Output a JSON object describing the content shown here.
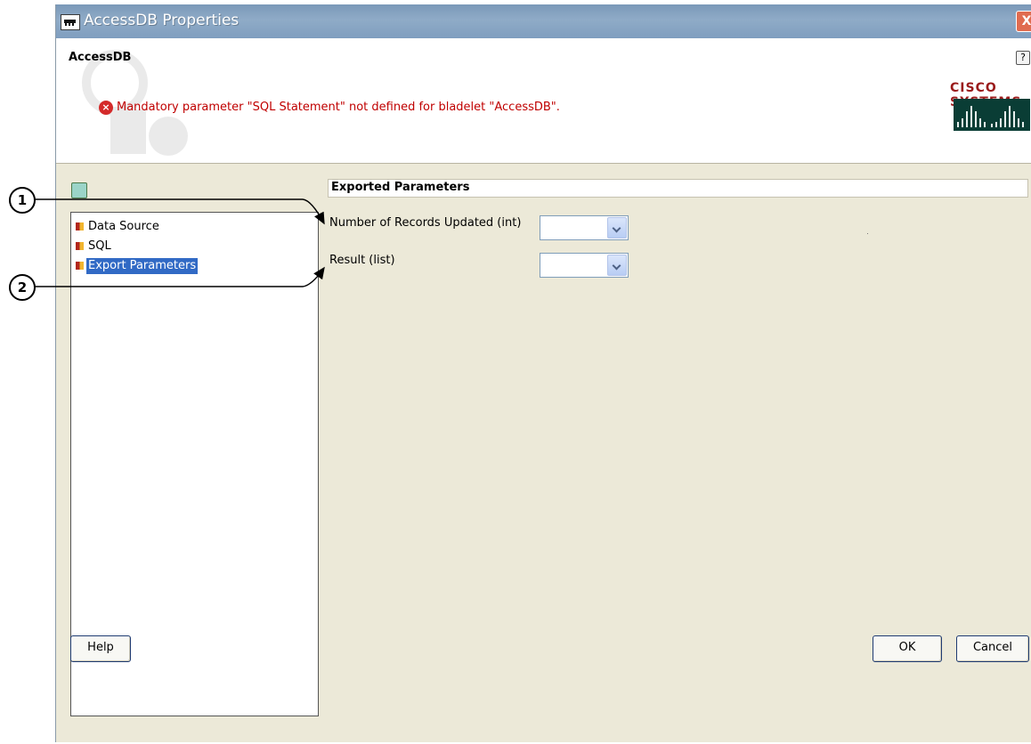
{
  "window": {
    "title": "AccessDB Properties",
    "close_label": "X"
  },
  "header": {
    "title": "AccessDB",
    "help_label": "?",
    "error_message": "Mandatory parameter \"SQL Statement\" not defined for bladelet \"AccessDB\".",
    "error_icon_label": "×",
    "logo_text": "CISCO SYSTEMS"
  },
  "tree": {
    "items": [
      {
        "label": "Data Source",
        "selected": false
      },
      {
        "label": "SQL",
        "selected": false
      },
      {
        "label": "Export Parameters",
        "selected": true
      }
    ]
  },
  "main": {
    "section_title": "Exported Parameters",
    "fields": [
      {
        "label": "Number of Records Updated (int)",
        "value": ""
      },
      {
        "label": "Result (list)",
        "value": ""
      }
    ]
  },
  "buttons": {
    "help": "Help",
    "ok": "OK",
    "cancel": "Cancel"
  },
  "callouts": [
    "1",
    "2"
  ],
  "colors": {
    "titlebar": "#8fabc7",
    "dialog_bg": "#ece9d8",
    "error_text": "#c00000",
    "selection": "#316ac5"
  }
}
